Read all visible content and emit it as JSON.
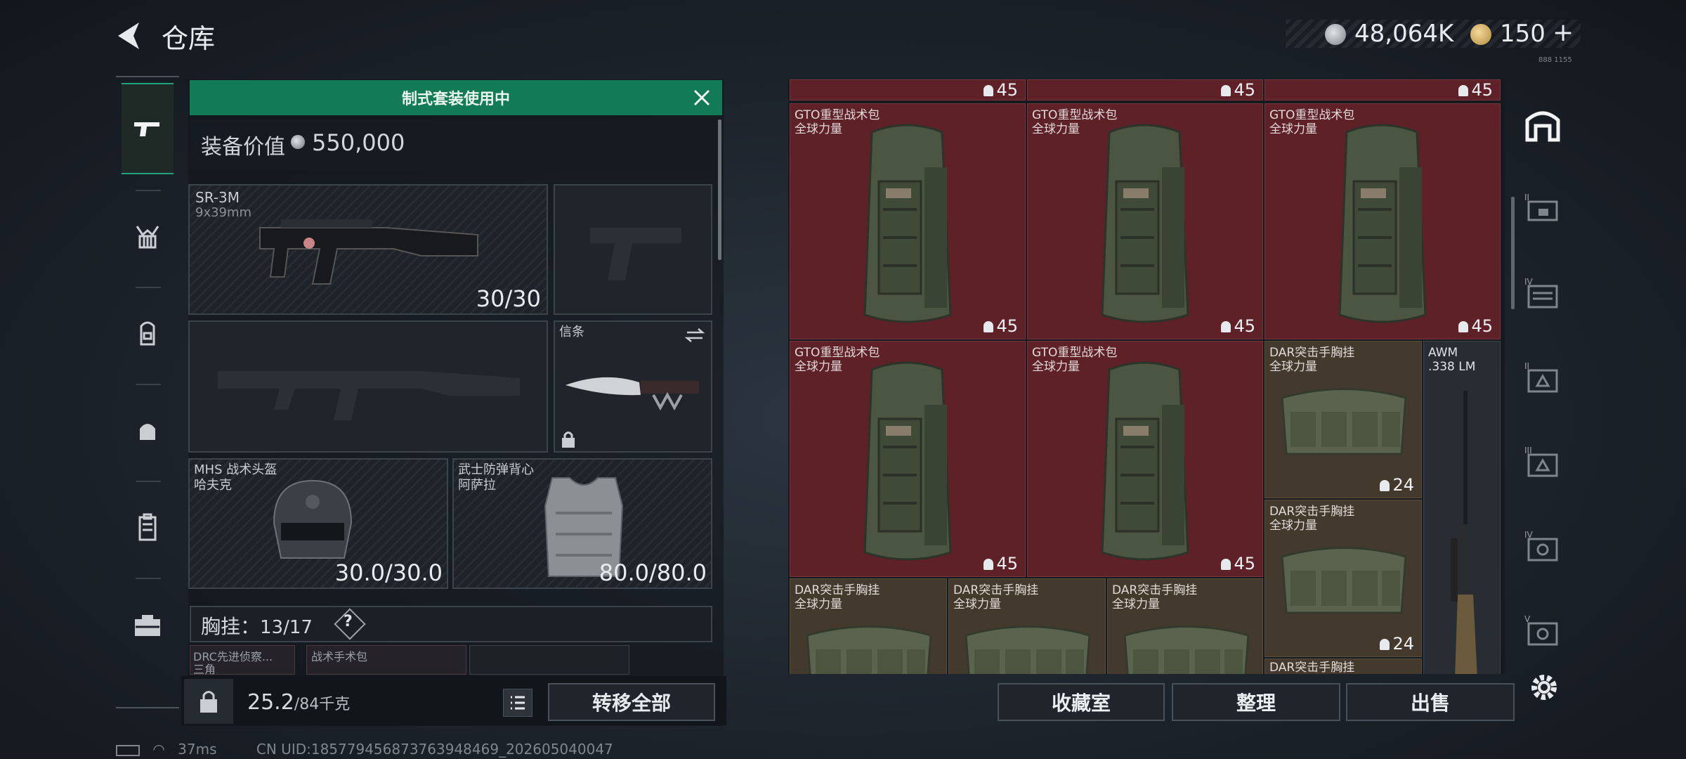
{
  "header": {
    "title": "仓库",
    "money": "48,064K",
    "bonds": "150",
    "plus": "+",
    "tiny": "888 1155"
  },
  "loadout": {
    "banner": "制式套装使用中",
    "value_label": "装备价值",
    "value_amount": "550,000",
    "primary": {
      "name": "SR-3M",
      "caliber": "9x39mm",
      "ammo": "30/30"
    },
    "knife": {
      "name": "信条"
    },
    "helmet": {
      "name": "MHS 战术头盔",
      "brand": "哈夫克",
      "durability": "30.0/30.0"
    },
    "armor": {
      "name": "武士防弹背心",
      "brand": "阿萨拉",
      "durability": "80.0/80.0"
    },
    "chest_label": "胸挂：",
    "chest_value": "13/17",
    "help": "?",
    "mini_items": [
      "DRC先进侦察...",
      "战术手术包",
      "三角"
    ],
    "weight_main": "25.2",
    "weight_rest": "/84千克",
    "transfer_label": "转移全部"
  },
  "storage": {
    "top_counts": [
      "45",
      "45",
      "45"
    ],
    "items": [
      {
        "name": "GTO重型战术包",
        "brand": "全球力量",
        "count": "45"
      },
      {
        "name": "GTO重型战术包",
        "brand": "全球力量",
        "count": "45"
      },
      {
        "name": "GTO重型战术包",
        "brand": "全球力量",
        "count": "45"
      },
      {
        "name": "GTO重型战术包",
        "brand": "全球力量",
        "count": "45"
      },
      {
        "name": "GTO重型战术包",
        "brand": "全球力量",
        "count": "45"
      },
      {
        "name": "DAR突击手胸挂",
        "brand": "全球力量",
        "count": "24"
      },
      {
        "name": "DAR突击手胸挂",
        "brand": "全球力量",
        "count": "24"
      },
      {
        "name": "DAR突击手胸挂",
        "brand": "全球力量",
        "count": ""
      },
      {
        "name": "DAR突击手胸挂",
        "brand": "全球力量",
        "count": ""
      },
      {
        "name": "DAR突击手胸挂",
        "brand": "全球力量",
        "count": ""
      },
      {
        "name": "DAR突击手胸挂",
        "brand": "",
        "count": ""
      }
    ],
    "awm": {
      "name": "AWM",
      "caliber": ".338 LM"
    }
  },
  "actions": {
    "collection": "收藏室",
    "sort": "整理",
    "sell": "出售"
  },
  "status": {
    "ping": "37ms",
    "uid": "CN UID:1857794568737639484​69_202605040047"
  },
  "colors": {
    "accent": "#127a57",
    "red_cell": "#5e2128",
    "brown_cell": "#433a2d"
  }
}
